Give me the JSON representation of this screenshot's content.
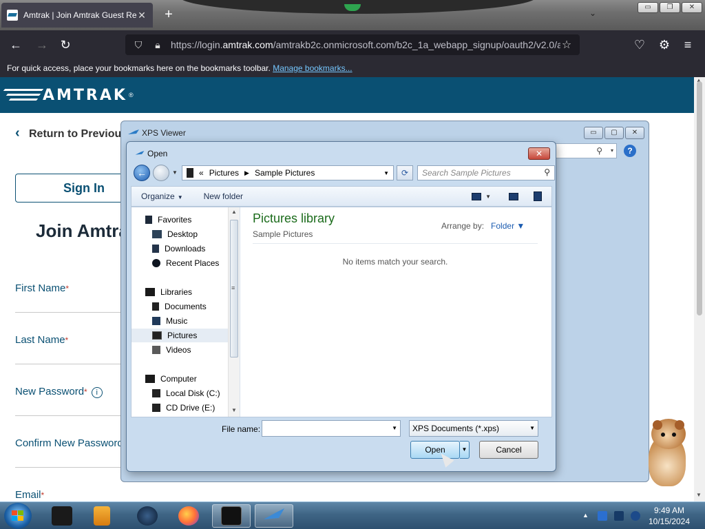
{
  "browser": {
    "tab_title": "Amtrak | Join Amtrak Guest Rewards",
    "tab_close": "✕",
    "new_tab": "+",
    "tab_list": "⌄",
    "url_prefix": "https://login.",
    "url_domain": "amtrak.com",
    "url_rest": "/amtrakb2c.onmicrosoft.com/b2c_1a_webapp_signup/oauth2/v2.0/a",
    "bookmarks_text": "For quick access, place your bookmarks here on the bookmarks toolbar.",
    "bookmarks_link": "Manage bookmarks...",
    "window_buttons": [
      "▭",
      "❐",
      "✕"
    ]
  },
  "page": {
    "logo_text": "AMTRAK",
    "logo_mark": "®",
    "back_link": "Return to Previous Page",
    "sign_in": "Sign In",
    "join_title": "Join Amtrak Guest Rewards",
    "required_mark": "*",
    "fields": [
      {
        "label": "First Name"
      },
      {
        "label": "Last Name"
      },
      {
        "label": "New Password",
        "info": "i"
      },
      {
        "label": "Confirm New Password"
      },
      {
        "label": "Email"
      }
    ]
  },
  "xps": {
    "title": "XPS Viewer",
    "buttons": [
      "▭",
      "▢",
      "✕"
    ],
    "search_icon": "⚲",
    "search_dd": "▾",
    "help": "?"
  },
  "dialog": {
    "title": "Open",
    "close": "✕",
    "back": "←",
    "path_prefix": "«",
    "path": [
      "Pictures",
      "Sample Pictures"
    ],
    "path_sep": "▶",
    "dd": "▼",
    "refresh": "⟳",
    "search_placeholder": "Search Sample Pictures",
    "search_icon": "⚲",
    "toolbar": {
      "organize": "Organize",
      "new_folder": "New folder"
    },
    "nav": {
      "favorites": "Favorites",
      "desktop": "Desktop",
      "downloads": "Downloads",
      "recent": "Recent Places",
      "libraries": "Libraries",
      "documents": "Documents",
      "music": "Music",
      "pictures": "Pictures",
      "videos": "Videos",
      "computer": "Computer",
      "local_disk": "Local Disk (C:)",
      "cd_drive": "CD Drive (E:)"
    },
    "scroll_up": "▲",
    "scroll_down": "▼",
    "scroll_grip": "≡",
    "library_title": "Pictures library",
    "library_sub": "Sample Pictures",
    "arrange_label": "Arrange by:",
    "arrange_value": "Folder ▼",
    "empty_message": "No items match your search.",
    "file_name_label": "File name:",
    "file_name_value": "",
    "file_type": "XPS Documents (*.xps)",
    "open": "Open",
    "cancel": "Cancel"
  },
  "taskbar": {
    "time": "9:49 AM",
    "date": "10/15/2024"
  },
  "colors": {
    "amtrak_blue": "#0a5073",
    "library_green": "#1b6b1b"
  }
}
